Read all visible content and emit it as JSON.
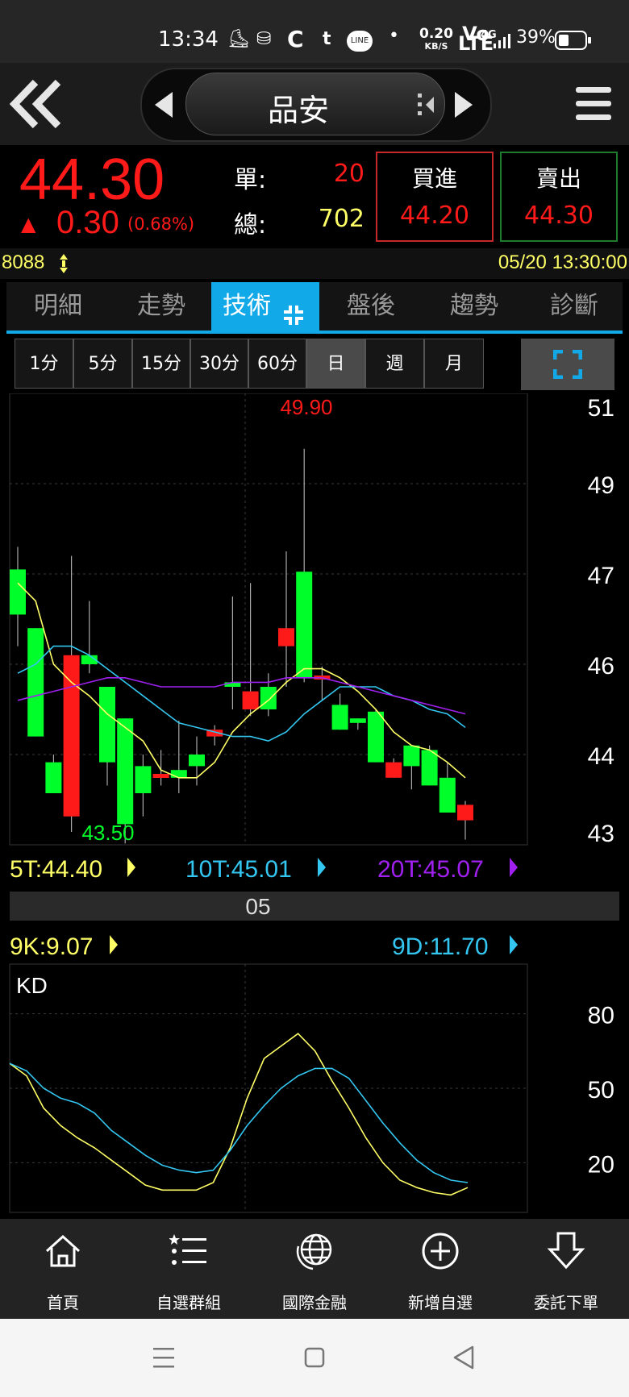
{
  "status_bar": {
    "time": "13:34",
    "net_speed_value": "0.20",
    "net_speed_unit": "KB/S",
    "volte_top": "Vo",
    "volte_bottom": "LTE",
    "network": "4G",
    "battery": "39%"
  },
  "header": {
    "title": "品安"
  },
  "quote": {
    "price": "44.30",
    "change_arrow": "▲",
    "change": "0.30",
    "change_pct": "(0.68%)",
    "single_label": "單:",
    "single_value": "20",
    "total_label": "總:",
    "total_value": "702",
    "buy_label": "買進",
    "buy_price": "44.20",
    "sell_label": "賣出",
    "sell_price": "44.30"
  },
  "info_bar": {
    "code": "8088",
    "datetime": "05/20 13:30:00"
  },
  "tabs": [
    "明細",
    "走勢",
    "技術",
    "盤後",
    "趨勢",
    "診斷"
  ],
  "active_tab": "技術",
  "periods": [
    "1分",
    "5分",
    "15分",
    "30分",
    "60分",
    "日",
    "週",
    "月"
  ],
  "selected_period": "日",
  "colors": {
    "up": "#ff1a1a",
    "down": "#00ff2a",
    "ma5": "#ffff66",
    "ma10": "#33c6f0",
    "ma20": "#a020f0",
    "accent": "#12a9e8"
  },
  "chart_data": [
    {
      "type": "candlestick",
      "y_ticks": [
        "51",
        "49",
        "47",
        "46",
        "44",
        "43"
      ],
      "max_label": "49.90",
      "min_label": "43.50",
      "x_label": "05",
      "candles": [
        {
          "o": 47.1,
          "c": 46.55,
          "h": 47.6,
          "l": 46.2
        },
        {
          "o": 46.4,
          "c": 44.4,
          "h": 46.4,
          "l": 44.4
        },
        {
          "o": 43.9,
          "c": 43.5,
          "h": 44.0,
          "l": 43.5
        },
        {
          "o": 43.2,
          "c": 46.1,
          "h": 47.4,
          "l": 43.0
        },
        {
          "o": 46.1,
          "c": 46.0,
          "h": 46.7,
          "l": 45.8
        },
        {
          "o": 45.5,
          "c": 43.9,
          "h": 45.5,
          "l": 43.6
        },
        {
          "o": 44.8,
          "c": 43.1,
          "h": 44.8,
          "l": 42.85
        },
        {
          "o": 43.85,
          "c": 43.5,
          "h": 44.0,
          "l": 43.2
        },
        {
          "o": 43.75,
          "c": 43.75,
          "h": 44.1,
          "l": 43.6
        },
        {
          "o": 43.8,
          "c": 43.7,
          "h": 44.75,
          "l": 43.5
        },
        {
          "o": 44.0,
          "c": 43.85,
          "h": 44.4,
          "l": 43.6
        },
        {
          "o": 44.4,
          "c": 44.55,
          "h": 44.65,
          "l": 44.2
        },
        {
          "o": 45.6,
          "c": 45.5,
          "h": 46.75,
          "l": 45.0
        },
        {
          "o": 45.0,
          "c": 45.4,
          "h": 46.9,
          "l": 44.85
        },
        {
          "o": 45.5,
          "c": 45.0,
          "h": 45.8,
          "l": 44.85
        },
        {
          "o": 46.2,
          "c": 46.4,
          "h": 47.5,
          "l": 45.5
        },
        {
          "o": 47.05,
          "c": 45.7,
          "h": 49.9,
          "l": 45.6
        },
        {
          "o": 45.7,
          "c": 45.75,
          "h": 45.95,
          "l": 45.2
        },
        {
          "o": 45.1,
          "c": 44.55,
          "h": 45.35,
          "l": 44.55
        },
        {
          "o": 44.8,
          "c": 44.7,
          "h": 44.8,
          "l": 44.55
        },
        {
          "o": 44.95,
          "c": 43.9,
          "h": 45.0,
          "l": 43.9
        },
        {
          "o": 43.7,
          "c": 43.9,
          "h": 43.95,
          "l": 43.7
        },
        {
          "o": 44.2,
          "c": 43.85,
          "h": 44.2,
          "l": 43.55
        },
        {
          "o": 44.1,
          "c": 43.6,
          "h": 44.2,
          "l": 43.6
        },
        {
          "o": 43.7,
          "c": 43.25,
          "h": 43.9,
          "l": 43.25
        },
        {
          "o": 43.15,
          "c": 43.35,
          "h": 43.4,
          "l": 42.9
        }
      ],
      "ma_series": [
        {
          "name": "5T",
          "value": "44.40",
          "values": [
            46.9,
            46.7,
            46.0,
            45.6,
            45.3,
            44.9,
            44.6,
            44.3,
            43.8,
            43.7,
            43.7,
            43.9,
            44.5,
            44.9,
            45.2,
            45.6,
            45.9,
            45.9,
            45.7,
            45.4,
            45.0,
            44.5,
            44.2,
            44.1,
            43.9,
            43.7
          ]
        },
        {
          "name": "10T",
          "value": "45.01",
          "values": [
            45.8,
            46.0,
            46.2,
            46.2,
            46.1,
            45.9,
            45.6,
            45.3,
            45.0,
            44.7,
            44.6,
            44.5,
            44.4,
            44.4,
            44.3,
            44.5,
            44.9,
            45.2,
            45.5,
            45.5,
            45.5,
            45.3,
            45.2,
            45.0,
            44.9,
            44.6
          ]
        },
        {
          "name": "20T",
          "value": "45.07",
          "values": [
            45.2,
            45.3,
            45.4,
            45.5,
            45.6,
            45.7,
            45.7,
            45.6,
            45.5,
            45.5,
            45.5,
            45.5,
            45.6,
            45.6,
            45.6,
            45.7,
            45.7,
            45.7,
            45.6,
            45.5,
            45.4,
            45.3,
            45.2,
            45.1,
            45.0,
            44.9
          ]
        }
      ]
    },
    {
      "type": "line",
      "title": "KD",
      "y_ticks": [
        "80",
        "50",
        "20"
      ],
      "ylim": [
        0,
        100
      ],
      "series": [
        {
          "name": "9K",
          "value": "9.07",
          "values": [
            60,
            55,
            42,
            35,
            30,
            26,
            21,
            16,
            11,
            9,
            9,
            9,
            12,
            26,
            46,
            62,
            67,
            72,
            65,
            53,
            42,
            30,
            20,
            13,
            10,
            8,
            7,
            10
          ]
        },
        {
          "name": "9D",
          "value": "11.70",
          "values": [
            60,
            57,
            50,
            46,
            44,
            40,
            33,
            28,
            23,
            19,
            17,
            16,
            17,
            25,
            35,
            43,
            50,
            55,
            58,
            58,
            54,
            45,
            36,
            28,
            21,
            16,
            13,
            12
          ]
        }
      ]
    }
  ],
  "bottom_nav": [
    "首頁",
    "自選群組",
    "國際金融",
    "新增自選",
    "委託下單"
  ]
}
